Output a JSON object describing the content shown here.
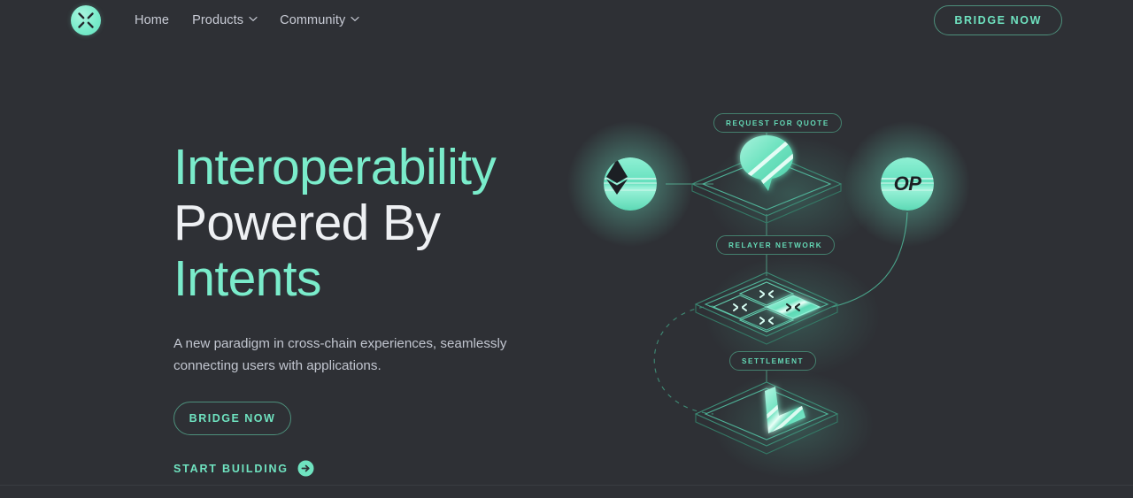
{
  "brand": {
    "logo_icon": "x-burst-logo-icon",
    "accent": "#7aeccb",
    "accent_dim": "#6fe3c0",
    "background": "#2e3035",
    "border_accent": "#4d8f7b"
  },
  "nav": {
    "items": [
      {
        "label": "Home",
        "has_dropdown": false,
        "icon": null
      },
      {
        "label": "Products",
        "has_dropdown": true,
        "icon": "chevron-down-icon"
      },
      {
        "label": "Community",
        "has_dropdown": true,
        "icon": "chevron-down-icon"
      }
    ],
    "cta": {
      "label": "BRIDGE NOW"
    }
  },
  "hero": {
    "headline_line1": "Interoperability",
    "headline_line2": "Powered By",
    "headline_line3": "Intents",
    "subtext": "A new paradigm in cross-chain experiences, seamlessly connecting users with applications.",
    "primary_cta": {
      "label": "BRIDGE NOW"
    },
    "secondary_cta": {
      "label": "START BUILDING",
      "icon": "arrow-right-circle-icon"
    }
  },
  "diagram": {
    "labels": {
      "rfq": "REQUEST FOR QUOTE",
      "relayer": "RELAYER NETWORK",
      "settlement": "SETTLEMENT"
    },
    "tokens": [
      {
        "name": "ethereum",
        "symbol": "",
        "icon": "ethereum-diamond-icon"
      },
      {
        "name": "optimism",
        "symbol": "OP",
        "icon": "optimism-op-icon"
      }
    ],
    "nodes": [
      {
        "name": "rfq-node",
        "icon": "speech-bubble-icon"
      },
      {
        "name": "relayer-node",
        "icon": "relayer-tiles-icon",
        "tiles": 4,
        "active_tile_index": 3
      },
      {
        "name": "settlement-node",
        "icon": "checkmark-icon"
      }
    ],
    "connectors": [
      {
        "from": "ethereum",
        "to": "rfq-node",
        "style": "solid"
      },
      {
        "from": "rfq-node",
        "to": "relayer-node",
        "style": "solid"
      },
      {
        "from": "optimism",
        "to": "relayer-node",
        "style": "solid-curve"
      },
      {
        "from": "relayer-node",
        "to": "settlement-node",
        "style": "dashed-arc"
      }
    ]
  }
}
